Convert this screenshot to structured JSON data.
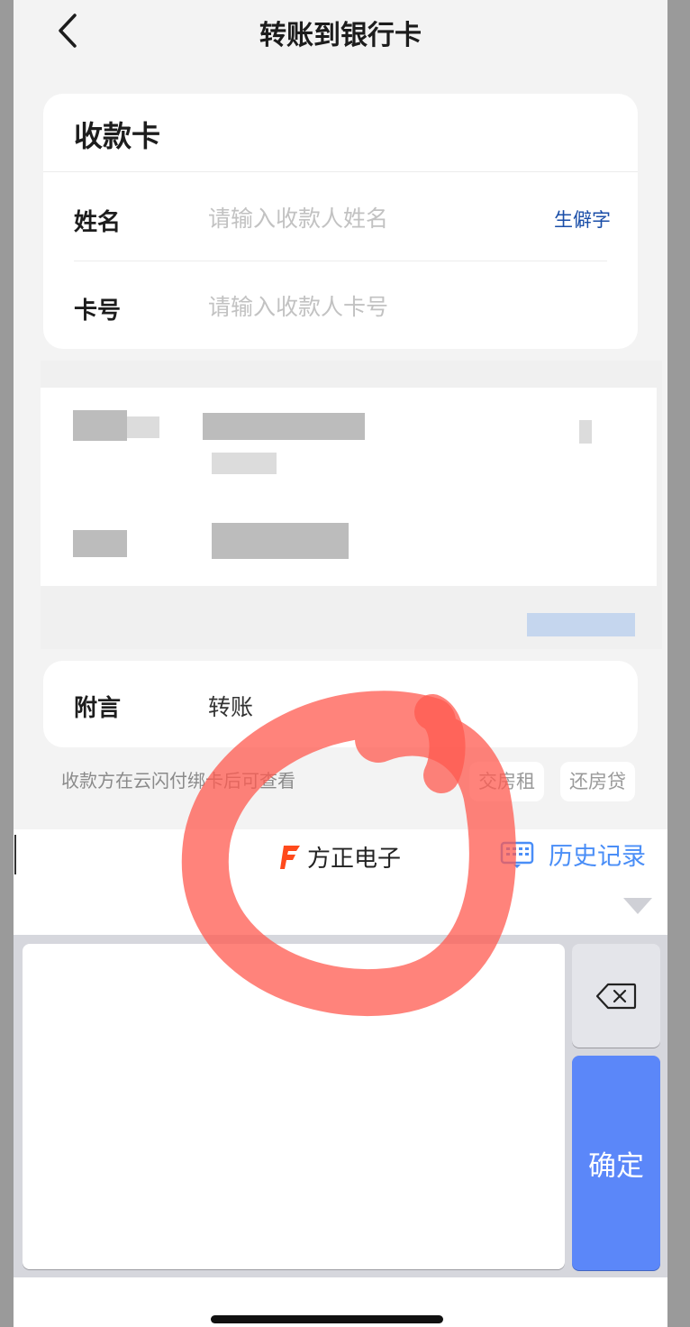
{
  "header": {
    "title": "转账到银行卡"
  },
  "receive_card": {
    "heading": "收款卡",
    "name_label": "姓名",
    "name_placeholder": "请输入收款人姓名",
    "rare_char_link": "生僻字",
    "card_label": "卡号",
    "card_placeholder": "请输入收款人卡号"
  },
  "note": {
    "label": "附言",
    "value": "转账",
    "hint": "收款方在云闪付绑卡后可查看",
    "chips": [
      "交房租",
      "还房贷"
    ]
  },
  "keyboard": {
    "brand_name": "方正电子",
    "history_label": "历史记录",
    "confirm_label": "确定"
  },
  "colors": {
    "accent": "#5b87f9",
    "link": "#1a4ea8",
    "brand": "#ff4a1c",
    "annotation": "#ff5a4f"
  }
}
